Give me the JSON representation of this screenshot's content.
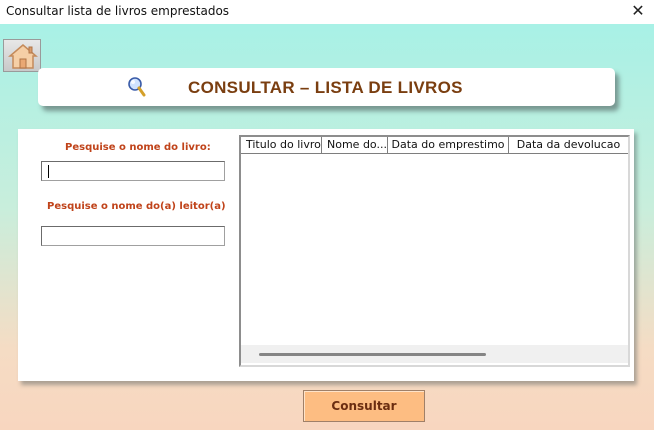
{
  "window": {
    "title": "Consultar lista de livros emprestados",
    "close_glyph": "✕"
  },
  "header": {
    "title": "CONSULTAR  – LISTA DE LIVROS",
    "icon": "magnifier-icon"
  },
  "home_button": {
    "icon": "home-icon"
  },
  "search": {
    "book_label": "Pesquise o nome do livro:",
    "book_value": "",
    "reader_label": "Pesquise o nome do(a) leitor(a)",
    "reader_value": ""
  },
  "list": {
    "columns": [
      "Titulo do livro",
      "Nome do...",
      "Data do emprestimo",
      "Data da devolucao"
    ],
    "rows": []
  },
  "action_button_label": "Consultar",
  "colors": {
    "title_brown": "#7a3e10",
    "label_orange": "#c0431a",
    "button_orange": "#fdbd82"
  }
}
